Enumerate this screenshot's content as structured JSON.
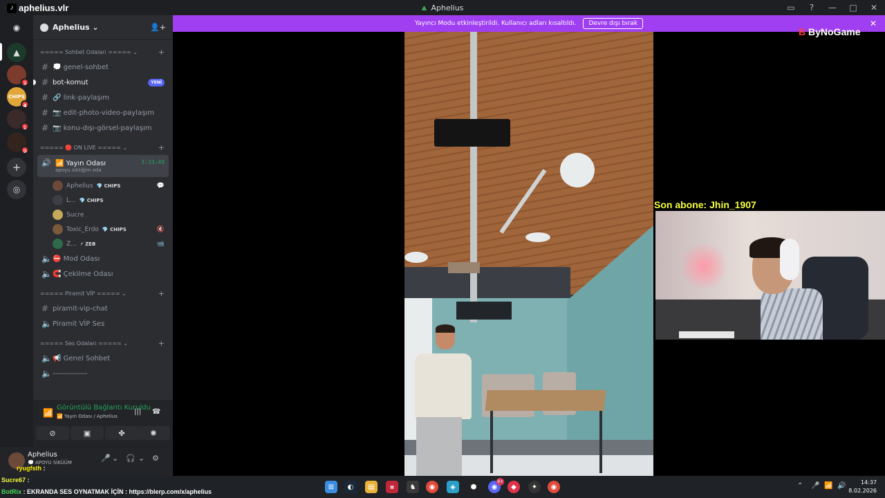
{
  "window": {
    "title": "Aphelius",
    "overlay_name": "aphelius.vlr"
  },
  "notice": {
    "text": "Yayıncı Modu etkinleştirildi. Kullanıcı adları kısaltıldı.",
    "button": "Devre dışı bırak",
    "close": "✕"
  },
  "rail": {
    "badges": [
      "3",
      "4",
      "1",
      "9"
    ],
    "server_labels": [
      "CHIPS"
    ]
  },
  "server": {
    "name": "Aphelius ⌄"
  },
  "categories": {
    "sohbet": "===== Sohbet Odaları ===== ⌄",
    "live": "===== 🔴 ON LIVE ===== ⌄",
    "piramit": "===== Piramit VİP ===== ⌄",
    "ses": "===== Ses Odaları ===== ⌄"
  },
  "channels": {
    "genel_sohbet": "💭 genel-sohbet",
    "bot_komut": "bot-komut",
    "new_badge": "YENİ",
    "link": "🔗 link-paylaşım",
    "edit_photo": "📷 edit-photo-video-paylaşım",
    "konu_disi": "📷 konu-dışı-görsel-paylaşım",
    "yayin_odasi": "📶 Yayın Odası",
    "yayin_sub": "apoyu siktiğim oda",
    "yayin_timer": "3:33:49",
    "mod_odasi": "⛔ Mod Odası",
    "cekilme": "🧲 Çekilme Odası",
    "piramit_chat": "piramit-vip-chat",
    "piramit_ses": "Piramit VİP Ses",
    "genel_voice": "📢 Genel Sohbet",
    "dashes": "--------------"
  },
  "members": [
    {
      "name": "Aphelius",
      "tag": "💎 CHIPS",
      "color": "#6b4a3a",
      "status": "💬"
    },
    {
      "name": "L...",
      "tag": "💎 CHIPS",
      "color": "#3d3d46",
      "status": ""
    },
    {
      "name": "Sucre",
      "tag": "",
      "color": "#c7a95a",
      "status": ""
    },
    {
      "name": "Toxic_Erdo",
      "tag": "💎 CHIPS",
      "color": "#7a5a3a",
      "status": "🔇"
    },
    {
      "name": "Z...",
      "tag": "⚡ ZEB",
      "color": "#2e6b4d",
      "status": "📹"
    }
  ],
  "voice_panel": {
    "status": "Görüntülü Bağlantı Kuruldu",
    "sub": "📶 Yayın Odası / Aphelius"
  },
  "user": {
    "name": "Aphelius",
    "sub": "💭 APOYU SİKÜÜM"
  },
  "chat_overlay": {
    "line1_name": "ryugfsth",
    "line1_sep": ":",
    "line2_name": "Sucre67",
    "line2_sep": ":",
    "botrix_name": "BotRix",
    "botrix_text": ": EKRANDA SES OYNATMAK İÇİN : https://blerp.com/x/aphelius"
  },
  "stream": {
    "subscriber": "Son abone: Jhin_1907",
    "sponsor": "ByNoGame",
    "sponsor_mark": "B"
  },
  "taskbar": {
    "discord_badge": "9+",
    "time": "14:37",
    "date": "8.02.2026"
  },
  "colors": {
    "accent": "#5865f2",
    "notice_bg": "#a03ff2",
    "online": "#23a55a"
  }
}
